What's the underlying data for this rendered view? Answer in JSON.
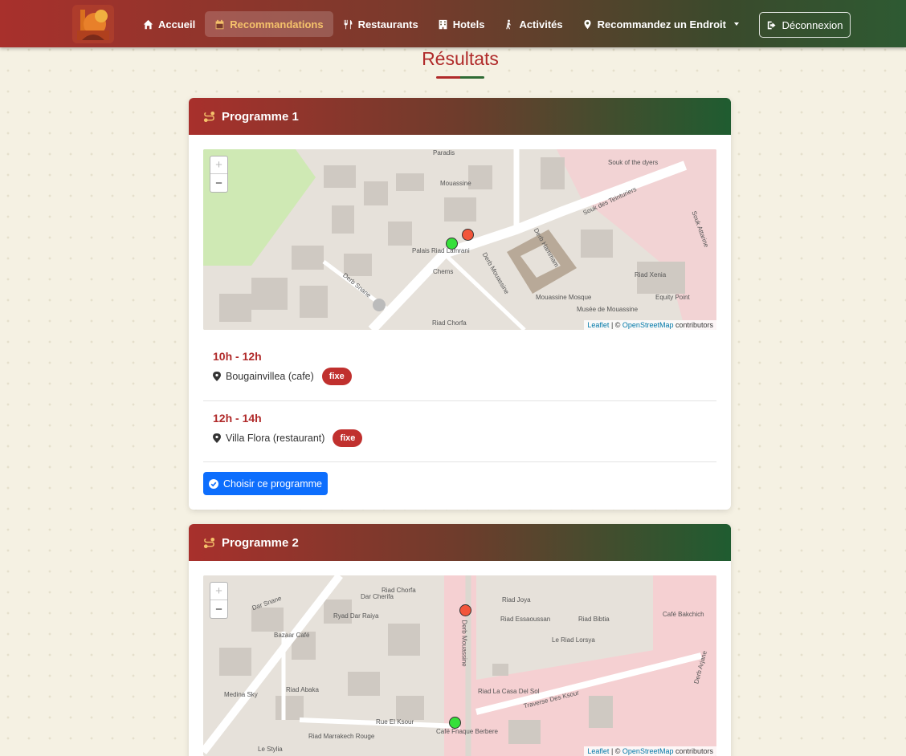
{
  "nav": {
    "items": [
      {
        "label": "Accueil",
        "icon": "home-icon",
        "active": false
      },
      {
        "label": "Recommandations",
        "icon": "calendar-icon",
        "active": true
      },
      {
        "label": "Restaurants",
        "icon": "utensils-icon",
        "active": false
      },
      {
        "label": "Hotels",
        "icon": "building-icon",
        "active": false
      },
      {
        "label": "Activités",
        "icon": "hiking-icon",
        "active": false
      },
      {
        "label": "Recommandez un Endroit",
        "icon": "map-marker-icon",
        "active": false
      }
    ],
    "logout_label": "Déconnexion"
  },
  "page": {
    "title": "Résultats"
  },
  "programmes": [
    {
      "title": "Programme 1",
      "map": {
        "zoom_in": "+",
        "zoom_out": "−",
        "attribution_leaflet": "Leaflet",
        "attribution_sep": " | © ",
        "attribution_osm": "OpenStreetMap",
        "attribution_contrib": " contributors",
        "labels": [
          "Paradis",
          "Mouassine",
          "Souk of the dyers",
          "Souk des Teinturiers",
          "Derb Hammam",
          "Palais Riad Lamrani",
          "Derb Mouassine",
          "Chems",
          "Derb Snane",
          "Mouassine Mosque",
          "Riad Xenia",
          "Equity Point",
          "Musée de Mouassine",
          "Souk Attarine",
          "Riad Chorfa"
        ]
      },
      "slots": [
        {
          "time": "10h - 12h",
          "place": "Bougainvillea (cafe)",
          "badge": "fixe"
        },
        {
          "time": "12h - 14h",
          "place": "Villa Flora (restaurant)",
          "badge": "fixe"
        }
      ],
      "button": "Choisir ce programme"
    },
    {
      "title": "Programme 2",
      "map": {
        "zoom_in": "+",
        "zoom_out": "−",
        "attribution_leaflet": "Leaflet",
        "attribution_sep": " | © ",
        "attribution_osm": "OpenStreetMap",
        "attribution_contrib": " contributors",
        "labels": [
          "Dar Snane",
          "Riad Chorfa",
          "Dar Cherifa",
          "Riad Joya",
          "Riad Essaoussan",
          "Riad Bibtia",
          "Café Bakchich",
          "Ryad Dar Raiya",
          "Bazaar Café",
          "Derb Mouassine",
          "Le Riad Lorsya",
          "Riad Abaka",
          "Medina Sky",
          "Riad La Casa Del Sol",
          "Traverse Des Ksour",
          "Rue El Ksour",
          "Riad Marrakech Rouge",
          "Café Fnaque Berbere",
          "Derb Arjane",
          "Le Stylia"
        ]
      }
    }
  ]
}
